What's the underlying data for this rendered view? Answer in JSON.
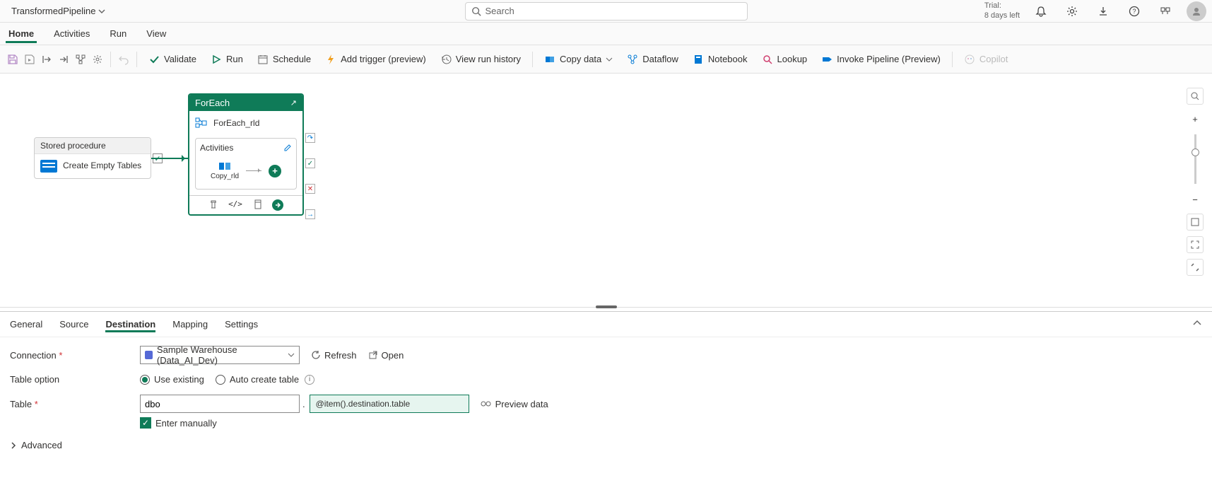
{
  "topbar": {
    "title": "TransformedPipeline",
    "search_placeholder": "Search",
    "trial_label": "Trial:",
    "trial_days": "8 days left"
  },
  "menutabs": [
    "Home",
    "Activities",
    "Run",
    "View"
  ],
  "ribbon": {
    "validate": "Validate",
    "run": "Run",
    "schedule": "Schedule",
    "add_trigger": "Add trigger (preview)",
    "view_history": "View run history",
    "copy_data": "Copy data",
    "dataflow": "Dataflow",
    "notebook": "Notebook",
    "lookup": "Lookup",
    "invoke": "Invoke Pipeline (Preview)",
    "copilot": "Copilot"
  },
  "canvas": {
    "sp_header": "Stored procedure",
    "sp_name": "Create Empty Tables",
    "fe_header": "ForEach",
    "fe_name": "ForEach_rld",
    "activities_label": "Activities",
    "copy_name": "Copy_rld"
  },
  "panel_tabs": [
    "General",
    "Source",
    "Destination",
    "Mapping",
    "Settings"
  ],
  "form": {
    "connection_label": "Connection",
    "connection_value": "Sample Warehouse (Data_AI_Dev)",
    "refresh": "Refresh",
    "open": "Open",
    "table_option_label": "Table option",
    "use_existing": "Use existing",
    "auto_create": "Auto create table",
    "table_label": "Table",
    "schema_value": "dbo",
    "table_expr": "@item().destination.table",
    "preview_data": "Preview data",
    "enter_manually": "Enter manually",
    "advanced": "Advanced"
  }
}
